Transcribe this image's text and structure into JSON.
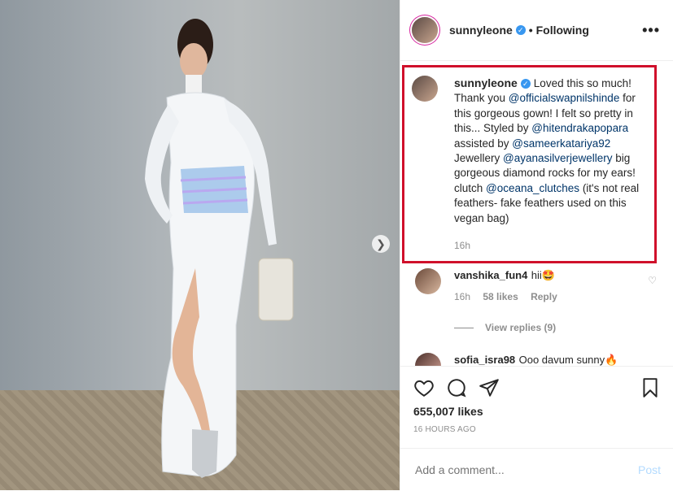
{
  "post": {
    "username": "sunnyleone",
    "follow_status": "• Following",
    "more_icon": "•••",
    "caption": {
      "username": "sunnyleone",
      "text_1": "Loved this so much! Thank you ",
      "mention_1": "@officialswapnilshinde",
      "text_2": " for this gorgeous gown! I felt so pretty in this... Styled by ",
      "mention_2": "@hitendrakapopara",
      "text_3": " assisted by ",
      "mention_3": "@sameerkatariya92",
      "text_4": " Jewellery ",
      "mention_4": "@ayanasilverjewellery",
      "text_5": " big gorgeous diamond rocks for my ears! clutch ",
      "mention_5": "@oceana_clutches",
      "text_6": " (it's not real feathers- fake feathers used on this vegan bag)",
      "time": "16h"
    },
    "comments": [
      {
        "username": "vanshika_fun4",
        "text": "hii🤩",
        "time": "16h",
        "likes": "58 likes",
        "reply": "Reply"
      },
      {
        "username": "sofia_isra98",
        "text": "Ooo davum sunny🔥"
      }
    ],
    "view_replies": "View replies (9)",
    "likes_count": "655,007 likes",
    "posted_time": "16 HOURS AGO",
    "comment_placeholder": "Add a comment...",
    "post_label": "Post",
    "icons": {
      "like": "heart-icon",
      "comment": "comment-icon",
      "share": "share-icon",
      "save": "bookmark-icon",
      "next": "chevron-right-icon"
    },
    "colors": {
      "highlight_border": "#d0102b",
      "mention": "#003569",
      "post_disabled": "#b3dbff"
    }
  }
}
